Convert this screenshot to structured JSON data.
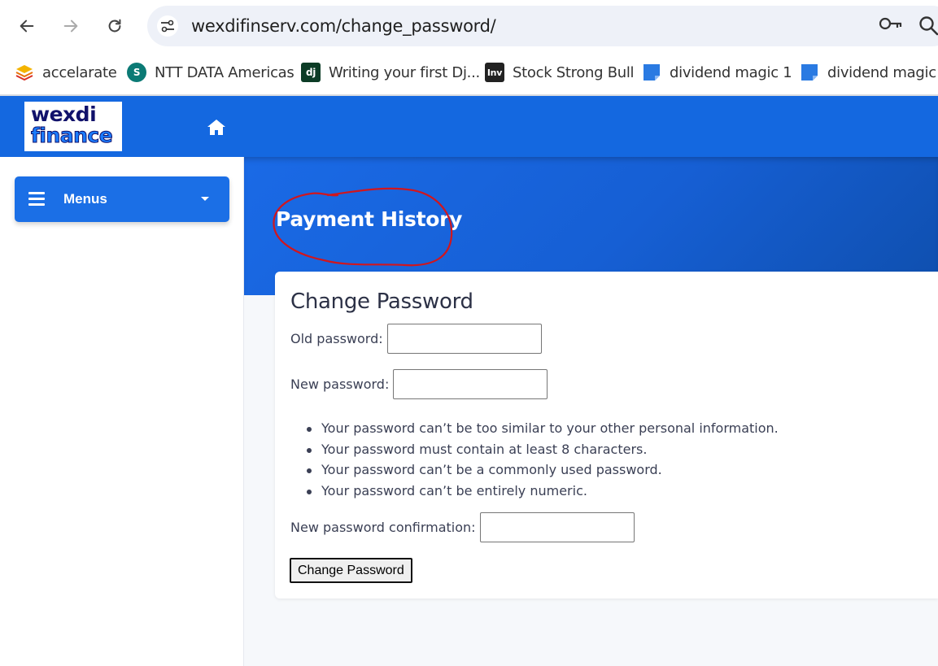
{
  "browser": {
    "url": "wexdifinserv.com/change_password/",
    "bookmarks": [
      {
        "label": "accelarate",
        "icon": "stack-icon",
        "color": "#f4b400"
      },
      {
        "label": "NTT DATA Americas",
        "icon": "sharepoint-icon",
        "color": "#0b7a75"
      },
      {
        "label": "Writing your first Dj...",
        "icon": "django-icon",
        "color": "#0c3c26"
      },
      {
        "label": "Stock Strong Bull",
        "icon": "investing-icon",
        "color": "#222222"
      },
      {
        "label": "dividend magic 1",
        "icon": "document-icon",
        "color": "#2a7ae2"
      },
      {
        "label": "dividend magic",
        "icon": "document-icon",
        "color": "#2a7ae2"
      }
    ]
  },
  "sidebar": {
    "logo_line1": "wexdi",
    "logo_line2": "finance",
    "menus_label": "Menus"
  },
  "hero": {
    "title": "Payment History"
  },
  "form": {
    "title": "Change Password",
    "old_password_label": "Old password:",
    "new_password_label": "New password:",
    "rules": [
      "Your password can’t be too similar to your other personal information.",
      "Your password must contain at least 8 characters.",
      "Your password can’t be a commonly used password.",
      "Your password can’t be entirely numeric."
    ],
    "confirm_label": "New password confirmation:",
    "submit_label": "Change Password"
  },
  "colors": {
    "brand_blue": "#1468e0",
    "annotation_red": "#d0161e"
  }
}
